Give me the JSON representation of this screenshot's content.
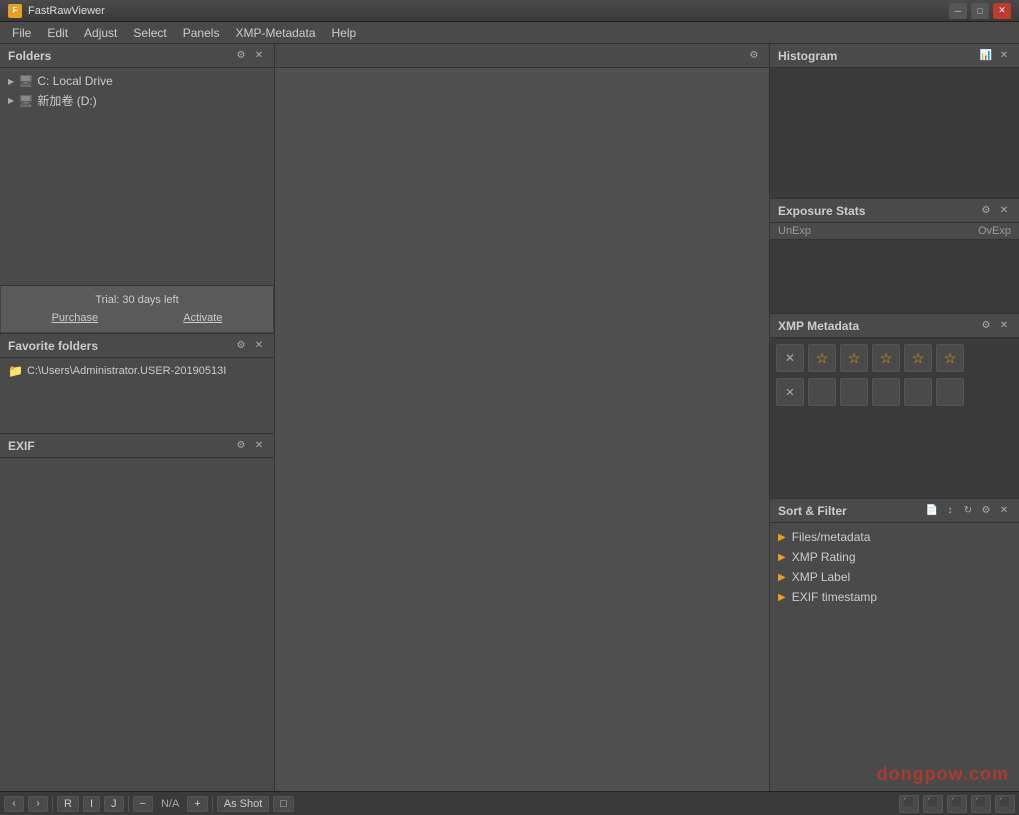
{
  "titleBar": {
    "appName": "FastRawViewer",
    "icon": "F",
    "minimizeLabel": "─",
    "maximizeLabel": "□",
    "closeLabel": "✕"
  },
  "menuBar": {
    "items": [
      "File",
      "Edit",
      "Adjust",
      "Select",
      "Panels",
      "XMP-Metadata",
      "Help"
    ]
  },
  "leftPanel": {
    "folders": {
      "title": "Folders",
      "items": [
        {
          "label": "C: Local Drive",
          "icon": "💻"
        },
        {
          "label": "新加卷 (D:)",
          "icon": "💻"
        }
      ]
    },
    "trial": {
      "text": "Trial: 30 days left",
      "purchaseLabel": "Purchase",
      "activateLabel": "Activate"
    },
    "favorite": {
      "title": "Favorite folders",
      "items": [
        {
          "label": "C:\\Users\\Administrator.USER-20190513I",
          "icon": "📁"
        }
      ]
    },
    "exif": {
      "title": "EXIF"
    }
  },
  "rightPanel": {
    "histogram": {
      "title": "Histogram"
    },
    "exposureStats": {
      "title": "Exposure Stats",
      "unexpLabel": "UnExp",
      "ovExpLabel": "OvExp"
    },
    "xmpMetadata": {
      "title": "XMP Metadata",
      "stars": [
        "✕",
        "☆",
        "☆",
        "☆",
        "☆",
        "☆"
      ],
      "starsRow2": [
        "✕",
        "□",
        "□",
        "□",
        "□",
        "□"
      ]
    },
    "sortFilter": {
      "title": "Sort & Filter",
      "items": [
        "Files/metadata",
        "XMP Rating",
        "XMP Label",
        "EXIF timestamp"
      ]
    }
  },
  "statusBar": {
    "navPrev": "‹",
    "navNext": "›",
    "rLabel": "R",
    "iLabel": "I",
    "jLabel": "J",
    "minusLabel": "−",
    "naLabel": "N/A",
    "plusLabel": "+",
    "asShotLabel": "As Shot",
    "squareLabel": "□"
  },
  "watermark": "dongpow.com"
}
